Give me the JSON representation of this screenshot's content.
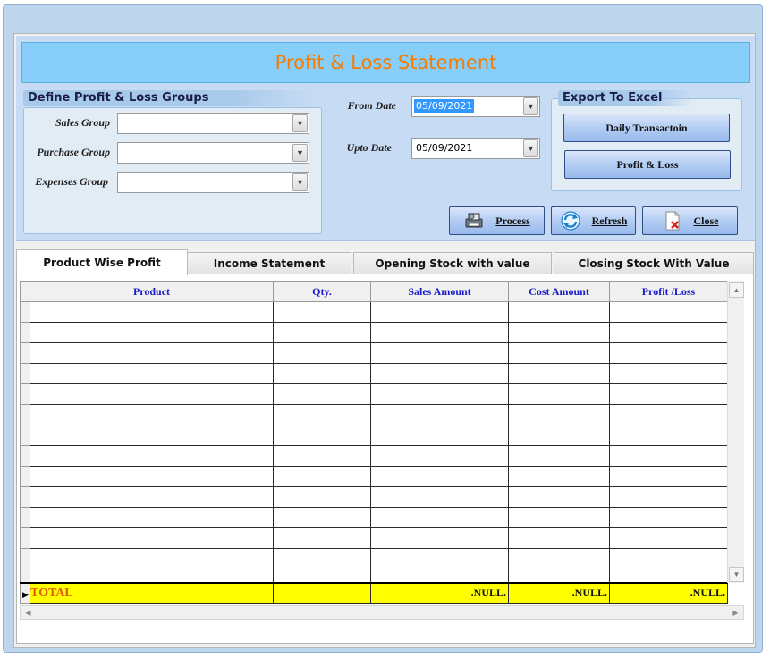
{
  "title": "Profit & Loss Statement",
  "groups_section": {
    "title": "Define Profit & Loss Groups",
    "sales_label": "Sales Group",
    "purchase_label": "Purchase Group",
    "expenses_label": "Expenses Group",
    "sales_value": "",
    "purchase_value": "",
    "expenses_value": ""
  },
  "dates": {
    "from_label": "From Date",
    "from_value": "05/09/2021",
    "upto_label": "Upto Date",
    "upto_value": "05/09/2021"
  },
  "export": {
    "title": "Export To Excel",
    "daily_label": "Daily Transactoin",
    "pl_label": "Profit & Loss"
  },
  "actions": {
    "process_label": "Process",
    "refresh_label": "Refresh",
    "close_label": "Close"
  },
  "tabs": [
    {
      "label": "Product Wise Profit"
    },
    {
      "label": "Income Statement"
    },
    {
      "label": "Opening Stock with value"
    },
    {
      "label": "Closing Stock  With Value"
    }
  ],
  "grid": {
    "columns": [
      "Product",
      "Qty.",
      "Sales Amount",
      "Cost Amount",
      "Profit /Loss"
    ],
    "total_label": "TOTAL",
    "total_sales": ".NULL.",
    "total_cost": ".NULL.",
    "total_profit": ".NULL."
  },
  "colors": {
    "title_text": "#f57c00",
    "title_bg": "#87cefa",
    "header_text": "#1a1acc",
    "total_bg": "#ffff00",
    "total_label": "#e05a00"
  }
}
